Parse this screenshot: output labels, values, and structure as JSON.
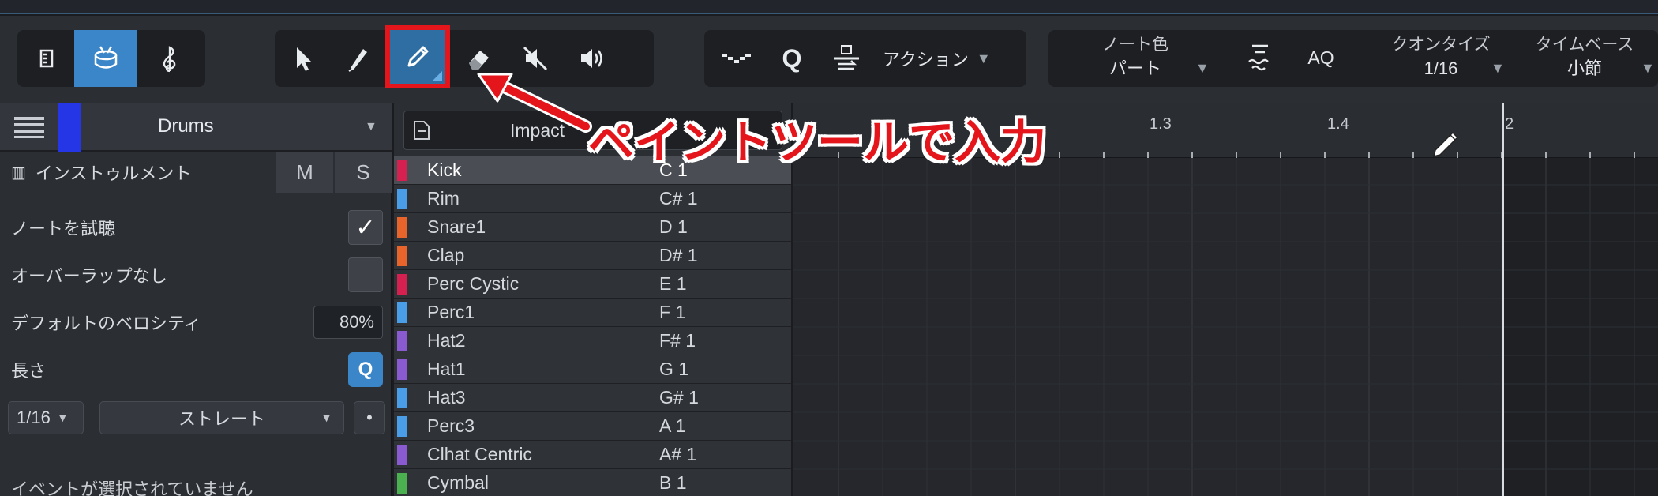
{
  "toolbar": {
    "action_label": "アクション",
    "note_color": {
      "label": "ノート色",
      "value": "パート"
    },
    "aq_label": "AQ",
    "quantize": {
      "label": "クオンタイズ",
      "value": "1/16"
    },
    "timebase": {
      "label": "タイムベース",
      "value": "小節"
    },
    "q_label": "Q"
  },
  "inspector": {
    "track_name": "Drums",
    "track_color": "#2436e6",
    "instrument_label": "インストゥルメント",
    "m_label": "M",
    "s_label": "S",
    "audition_label": "ノートを試聴",
    "audition_checked": "✓",
    "overlap_label": "オーバーラップなし",
    "velocity_label": "デフォルトのベロシティ",
    "velocity_value": "80%",
    "length_label": "長さ",
    "length_q": "Q",
    "length_value": "1/16",
    "straight_label": "ストレート",
    "dot_label": "•",
    "no_event_label": "イベントが選択されていません"
  },
  "drum_list": {
    "title": "Impact",
    "rows": [
      {
        "name": "Kick",
        "note": "C 1",
        "color": "#d6204f"
      },
      {
        "name": "Rim",
        "note": "C# 1",
        "color": "#4a9ee8"
      },
      {
        "name": "Snare1",
        "note": "D 1",
        "color": "#e8642a"
      },
      {
        "name": "Clap",
        "note": "D# 1",
        "color": "#e8642a"
      },
      {
        "name": "Perc Cystic",
        "note": "E 1",
        "color": "#d6204f"
      },
      {
        "name": "Perc1",
        "note": "F 1",
        "color": "#4a9ee8"
      },
      {
        "name": "Hat2",
        "note": "F# 1",
        "color": "#8a5ad0"
      },
      {
        "name": "Hat1",
        "note": "G 1",
        "color": "#8a5ad0"
      },
      {
        "name": "Hat3",
        "note": "G# 1",
        "color": "#4a9ee8"
      },
      {
        "name": "Perc3",
        "note": "A 1",
        "color": "#4a9ee8"
      },
      {
        "name": "Clhat Centric",
        "note": "A# 1",
        "color": "#8a5ad0"
      },
      {
        "name": "Cymbal",
        "note": "B 1",
        "color": "#4ab050"
      }
    ]
  },
  "ruler": {
    "marks": [
      "1.3",
      "1.4",
      "2"
    ]
  },
  "annotation": {
    "text": "ペイントツールで入力",
    "color": "#e4161c"
  }
}
